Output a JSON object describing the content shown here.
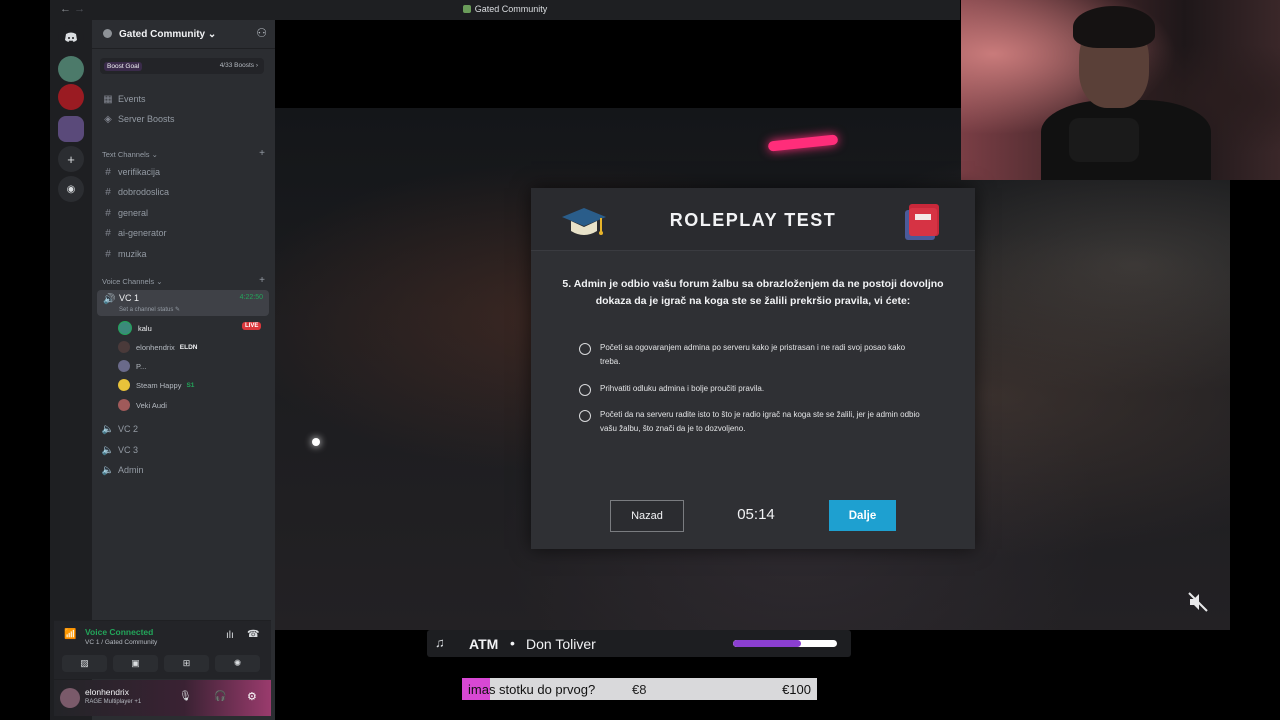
{
  "window": {
    "title": "Gated Community",
    "nav_back": "←",
    "nav_fwd": "→"
  },
  "server": {
    "name": "Gated Community ⌄",
    "boost_goal": "Boost Goal",
    "boost_count": "4/33 Boosts ›",
    "top_items": [
      {
        "label": "Events",
        "icon": "calendar-icon"
      },
      {
        "label": "Server Boosts",
        "icon": "boost-icon"
      }
    ],
    "text_category": "Text Channels ⌄",
    "text_channels": [
      "verifikacija",
      "dobrodoslica",
      "general",
      "ai-generator",
      "muzika"
    ],
    "voice_category": "Voice Channels ⌄",
    "active_voice": {
      "name": "VC 1",
      "status": "Set a channel status ✎",
      "time": "4:22:50"
    },
    "voice_users": [
      {
        "name": "kalu",
        "badge": "LIVE"
      },
      {
        "name": "elonhendrix",
        "tag": "ELDN"
      },
      {
        "name": "P..."
      },
      {
        "name": "Steam Happy",
        "tag": "S1"
      },
      {
        "name": "Veki Audi"
      }
    ],
    "other_voice": [
      "VC 2",
      "VC 3",
      "Admin"
    ]
  },
  "voice_panel": {
    "status": "Voice Connected",
    "sub": "VC 1 / Gated Community"
  },
  "user_panel": {
    "name": "elonhendrix",
    "activity": "RAGE Multiplayer +1"
  },
  "quiz": {
    "title": "ROLEPLAY TEST",
    "question": "5. Admin je odbio vašu forum žalbu sa obrazloženjem da ne postoji dovoljno dokaza da je igrač na koga ste se žalili prekršio pravila, vi ćete:",
    "options": [
      "Početi sa ogovaranjem admina po serveru kako je pristrasan i ne radi svoj posao kako treba.",
      "Prihvatiti odluku admina i bolje proučiti pravila.",
      "Početi da na serveru radite isto to što je radio igrač na koga ste se žalili, jer je admin odbio vašu žalbu, što znači da je to dozvoljeno."
    ],
    "back_label": "Nazad",
    "timer": "05:14",
    "next_label": "Dalje"
  },
  "now_playing": {
    "artist": "ATM",
    "separator": "•",
    "song": "Don Toliver",
    "progress": 0.65
  },
  "donation": {
    "question": "imas stotku do prvog?",
    "current": "€8",
    "goal": "€100",
    "progress": 0.08
  },
  "colors": {
    "accent_blue": "#1ea0d0",
    "discord_green": "#23a55a",
    "live_red": "#da373c",
    "music_purple": "#8b3fd1",
    "donation_pink": "#d848d4"
  }
}
